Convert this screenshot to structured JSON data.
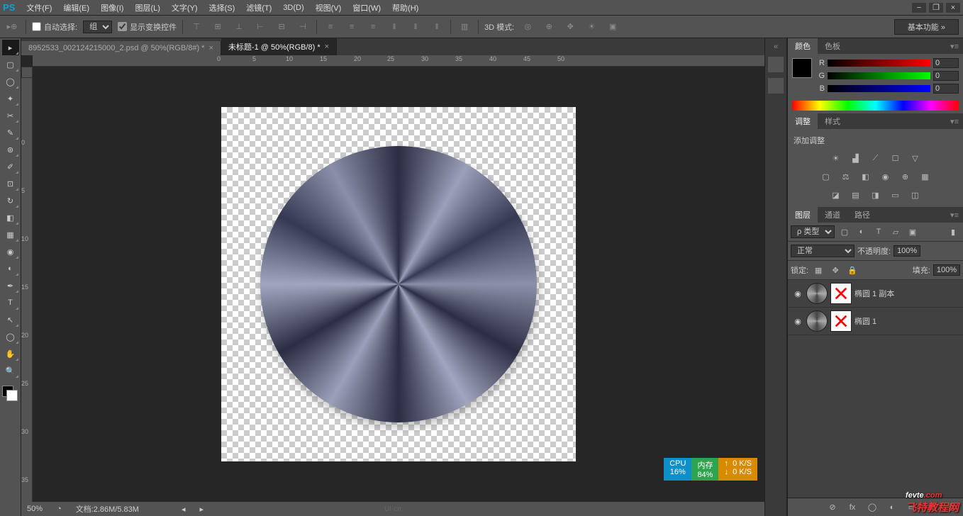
{
  "menu": {
    "items": [
      "文件(F)",
      "编辑(E)",
      "图像(I)",
      "图层(L)",
      "文字(Y)",
      "选择(S)",
      "滤镜(T)",
      "3D(D)",
      "视图(V)",
      "窗口(W)",
      "帮助(H)"
    ]
  },
  "logo": "PS",
  "options": {
    "auto_select": "自动选择:",
    "group": "组",
    "show_transform": "显示变换控件",
    "mode_3d": "3D 模式:",
    "workspace": "基本功能"
  },
  "tabs": [
    {
      "label": "8952533_002124215000_2.psd @ 50%(RGB/8#) *",
      "active": false
    },
    {
      "label": "未标题-1 @ 50%(RGB/8) *",
      "active": true
    }
  ],
  "ruler_h": [
    "0",
    "5",
    "10",
    "15",
    "20",
    "25",
    "30",
    "35",
    "40",
    "45",
    "50"
  ],
  "ruler_v": [
    "0",
    "5",
    "10",
    "15",
    "20",
    "25",
    "30",
    "35"
  ],
  "perf": {
    "cpu_label": "CPU",
    "cpu_val": "16%",
    "mem_label": "内存",
    "mem_val": "84%",
    "arrows": "↑ ↓",
    "disk1": "0 K/S",
    "disk2": "0 K/S"
  },
  "status": {
    "zoom": "50%",
    "doc": "文档:2.86M/5.83M"
  },
  "panels": {
    "color_tab": "颜色",
    "swatch_tab": "色板",
    "rgb": {
      "r_label": "R",
      "r_val": "0",
      "g_label": "G",
      "g_val": "0",
      "b_label": "B",
      "b_val": "0"
    },
    "adjust_tab": "调整",
    "style_tab": "样式",
    "adjust_add": "添加调整",
    "layers_tab": "图层",
    "channel_tab": "通道",
    "path_tab": "路径",
    "filter_kind_prefix": "ρ",
    "filter_kind": "类型",
    "blend": "正常",
    "opacity_label": "不透明度:",
    "opacity_val": "100%",
    "lock_label": "锁定:",
    "fill_label": "填充:",
    "fill_val": "100%",
    "layer1": "椭圆 1 副本",
    "layer2": "椭圆 1"
  },
  "watermark": {
    "brand": "fevte",
    "dot": ".com",
    "cn": "飞特教程网"
  },
  "uicn": "UI·cn"
}
